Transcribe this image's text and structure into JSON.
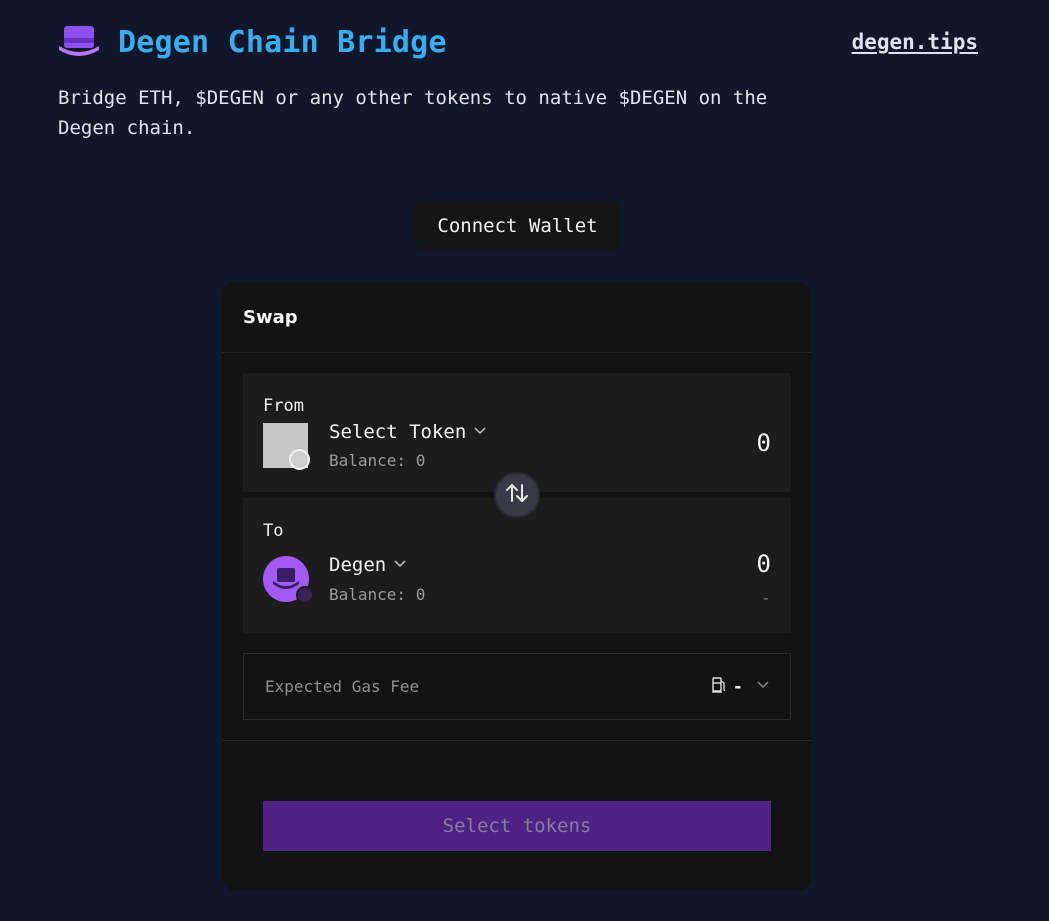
{
  "header": {
    "title": "Degen Chain Bridge",
    "link": "degen.tips",
    "subtitle": "Bridge ETH, $DEGEN or any other tokens to native $DEGEN on the Degen chain."
  },
  "connect_wallet_label": "Connect Wallet",
  "swap": {
    "title": "Swap",
    "from": {
      "label": "From",
      "token": "Select Token",
      "balance": "Balance: 0",
      "amount": "0"
    },
    "to": {
      "label": "To",
      "token": "Degen",
      "balance": "Balance: 0",
      "amount": "0",
      "usd": "-"
    },
    "gas": {
      "label": "Expected Gas Fee",
      "value": "-"
    },
    "action_label": "Select tokens"
  },
  "colors": {
    "background": "#10172a",
    "title": "#38aef0",
    "accent": "#a35af5",
    "button": "#4c2384"
  },
  "icons": {
    "logo": "top-hat-icon",
    "swap": "swap-arrows-icon",
    "gas": "fuel-pump-icon",
    "chevron": "chevron-down-icon"
  }
}
